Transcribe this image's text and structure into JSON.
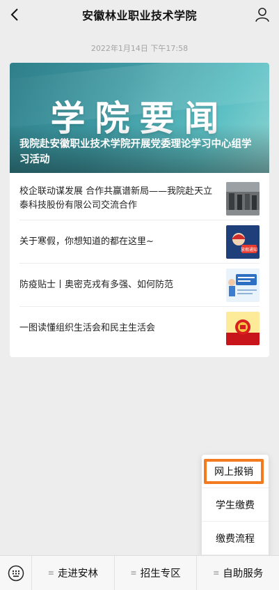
{
  "header": {
    "title": "安徽林业职业技术学院"
  },
  "timestamp": "2022年1月14日 下午17:58",
  "article_card": {
    "cover_title": "学院要闻",
    "headline": "我院赴安徽职业技术学院开展党委理论学习中心组学习活动",
    "items": [
      {
        "title": "校企联动谋发展 合作共赢谱新局——我院赴天立泰科技股份有限公司交流合作",
        "thumb": "meeting-photo"
      },
      {
        "title": "关于寒假，你想知道的都在这里~",
        "thumb": "holiday-notice-graphic",
        "thumb_label": "放假通知"
      },
      {
        "title": "防疫贴士丨奥密克戎有多强、如何防范",
        "thumb": "epidemic-tips-graphic"
      },
      {
        "title": "一图读懂组织生活会和民主生活会",
        "thumb": "party-emblem-graphic"
      }
    ]
  },
  "popup_menu": {
    "items": [
      "网上报销",
      "学生缴费",
      "缴费流程"
    ]
  },
  "bottom_menu": {
    "items": [
      "走进安林",
      "招生专区",
      "自助服务"
    ]
  },
  "colors": {
    "accent_orange": "#f37a1f",
    "page_bg": "#ededed",
    "cover_teal": "#3f9aa3"
  }
}
